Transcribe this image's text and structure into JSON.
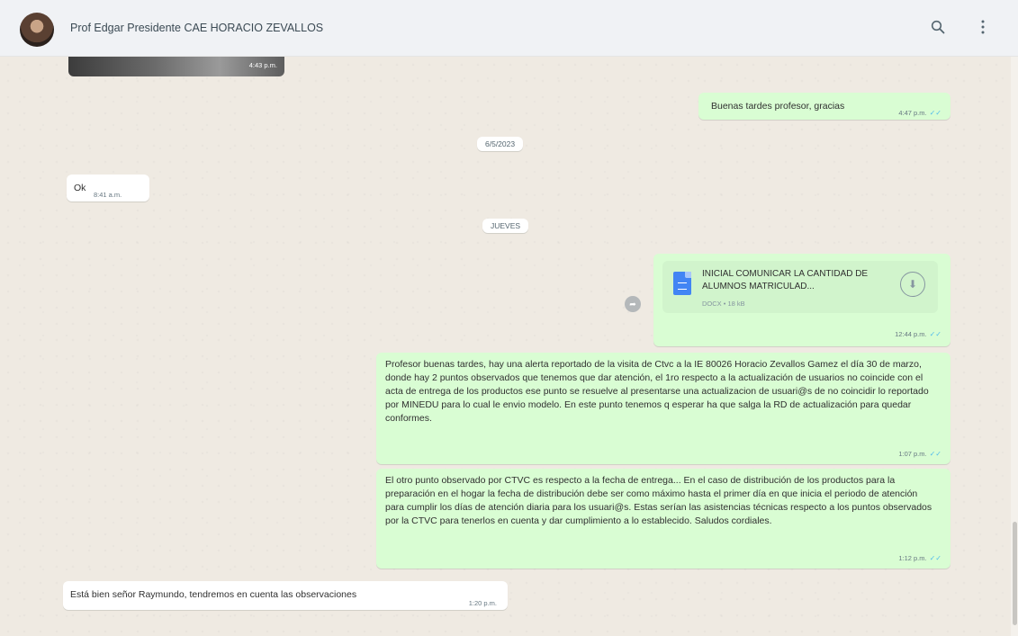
{
  "header": {
    "contact_name": "Prof Edgar Presidente CAE HORACIO ZEVALLOS",
    "icons": [
      "search-icon",
      "menu-icon"
    ]
  },
  "media": {
    "time": "4:43 p.m."
  },
  "messages": [
    {
      "id": "m1",
      "direction": "out",
      "text": "Buenas tardes profesor, gracias",
      "time": "4:47 p.m."
    },
    {
      "id": "m2",
      "direction": "in",
      "text": "Ok",
      "time": "8:41 a.m."
    },
    {
      "id": "m3",
      "direction": "out",
      "type": "document",
      "file_name": "INICIAL COMUNICAR LA CANTIDAD DE ALUMNOS MATRICULAD...",
      "file_meta": "DOCX • 18 kB",
      "time": "12:44 p.m."
    },
    {
      "id": "m4",
      "direction": "out",
      "text": "Profesor buenas tardes, hay una alerta reportado de la visita de Ctvc a la IE 80026 Horacio Zevallos Gamez el día 30 de marzo, donde hay 2 puntos observados que tenemos que dar atención, el 1ro respecto a la actualización de usuarios no coincide con el acta de entrega de los productos ese punto se resuelve al presentarse una actualizacion de usuari@s de no coincidir lo reportado por MINEDU para lo cual le envio modelo. En este punto tenemos q esperar ha que salga la RD de actualización para quedar conformes.",
      "time": "1:07 p.m."
    },
    {
      "id": "m5",
      "direction": "out",
      "text": "El otro punto observado por CTVC es respecto a la fecha de entrega... En el caso de distribución de los productos para la preparación en el hogar la fecha de distribución debe ser como máximo hasta el primer día en que inicia el periodo de atención para cumplir los días de atención diaria para los usuari@s. Estas serían las asistencias técnicas respecto a los puntos observados por la CTVC para tenerlos en cuenta y dar cumplimiento a lo establecido. Saludos cordiales.",
      "time": "1:12 p.m."
    },
    {
      "id": "m6",
      "direction": "in",
      "text": "Está bien señor Raymundo, tendremos en cuenta las observaciones",
      "time": "1:20 p.m."
    }
  ],
  "date_separators": [
    "6/5/2023",
    "JUEVES"
  ],
  "colors": {
    "incoming": "#ffffff",
    "outgoing": "#d9fdd3",
    "wallpaper": "#efeae2",
    "read_tick": "#53bdeb"
  }
}
